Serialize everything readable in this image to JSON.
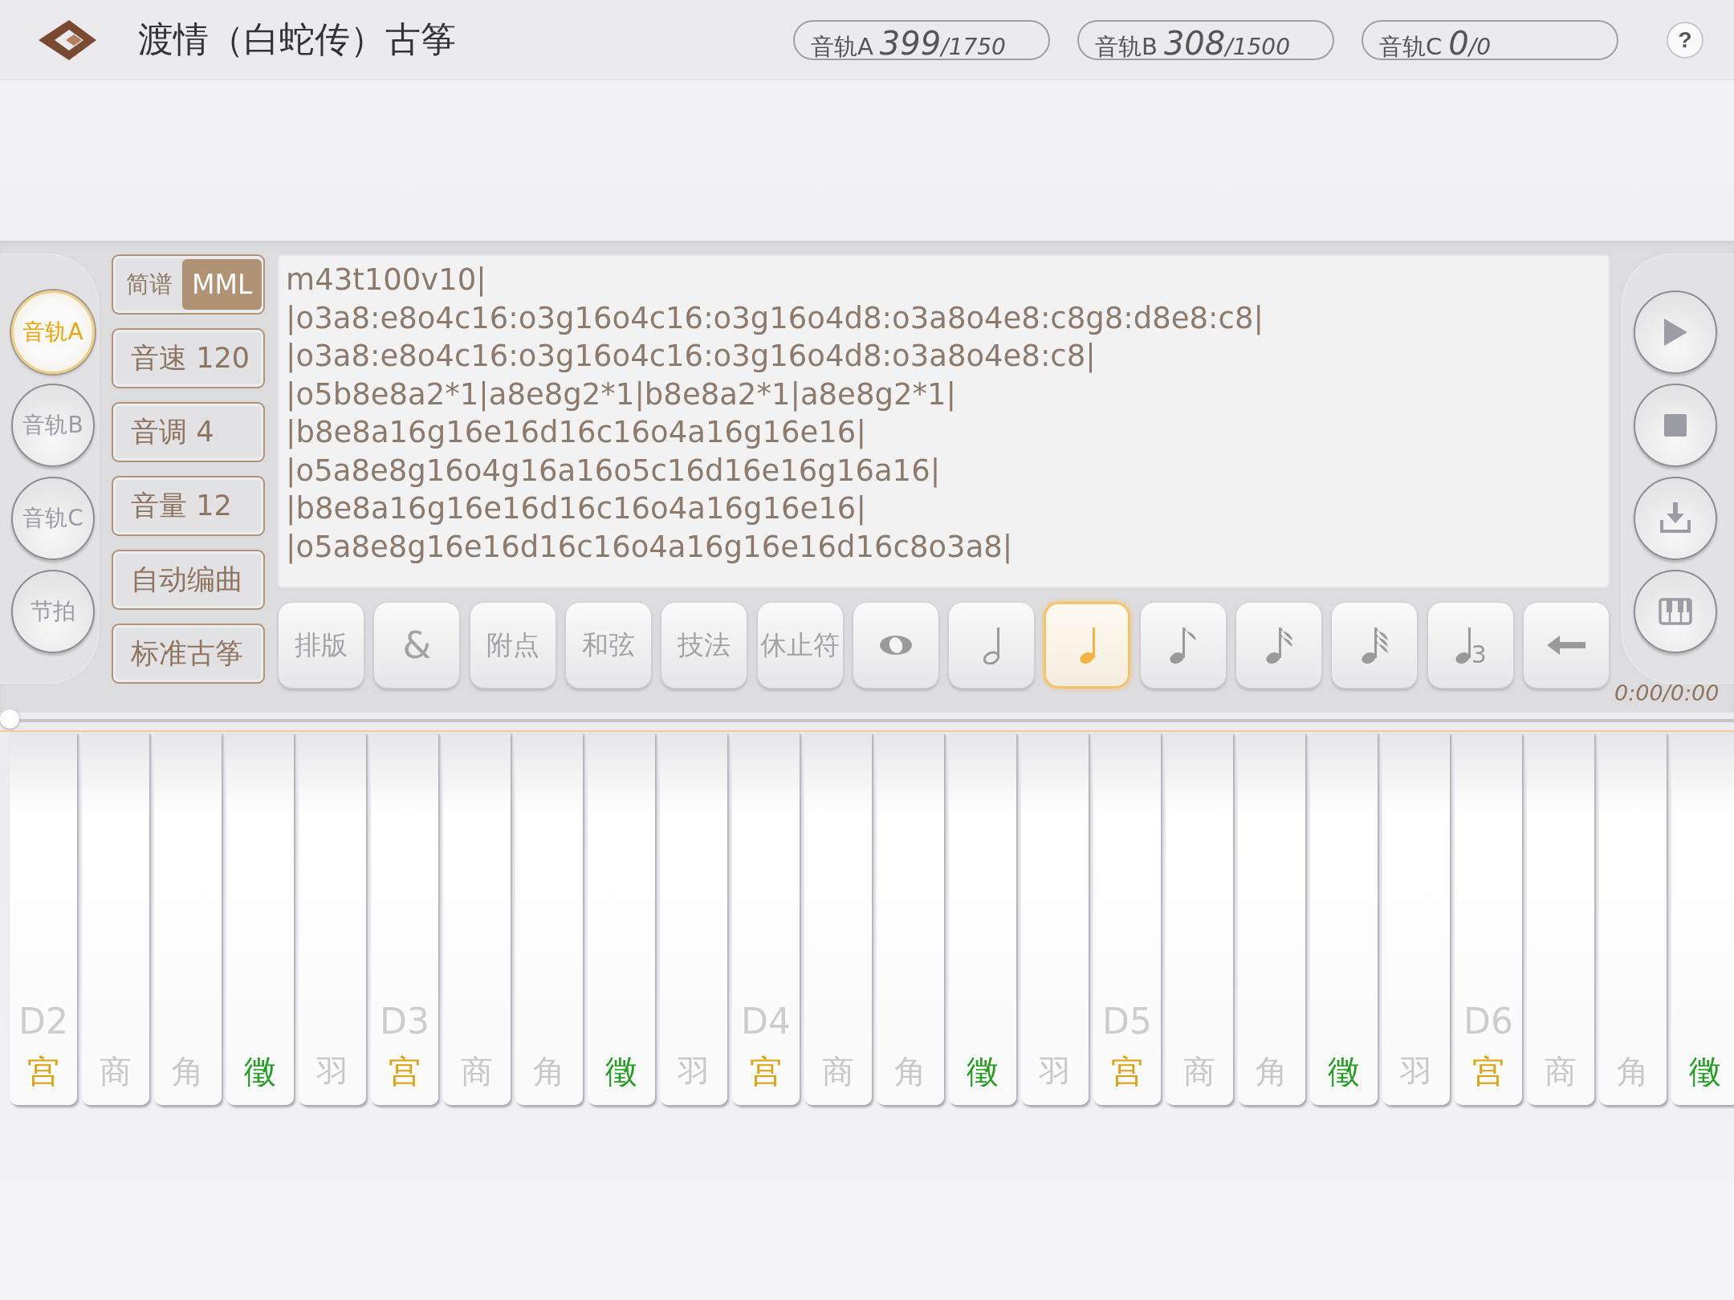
{
  "header": {
    "title": "渡情（白蛇传）古筝",
    "help": "?",
    "tracks": [
      {
        "label": "音轨A",
        "count": "399",
        "total": "/1750"
      },
      {
        "label": "音轨B",
        "count": "308",
        "total": "/1500"
      },
      {
        "label": "音轨C",
        "count": "0",
        "total": "/0"
      }
    ]
  },
  "track_buttons": [
    {
      "label": "音轨A",
      "selected": true
    },
    {
      "label": "音轨B",
      "selected": false
    },
    {
      "label": "音轨C",
      "selected": false
    },
    {
      "label": "节拍",
      "selected": false
    }
  ],
  "mode_toggle": [
    {
      "label": "简谱",
      "selected": false
    },
    {
      "label": "MML",
      "selected": true
    }
  ],
  "settings": [
    "音速 120",
    "音调 4",
    "音量 12",
    "自动编曲",
    "标准古筝"
  ],
  "editor_lines": [
    "m43t100v10|",
    "|o3a8:e8o4c16:o3g16o4c16:o3g16o4d8:o3a8o4e8:c8g8:d8e8:c8|",
    "|o3a8:e8o4c16:o3g16o4c16:o3g16o4d8:o3a8o4e8:c8|",
    "|o5b8e8a2*1|a8e8g2*1|b8e8a2*1|a8e8g2*1|",
    "|b8e8a16g16e16d16c16o4a16g16e16|",
    "|o5a8e8g16o4g16a16o5c16d16e16g16a16|",
    "|b8e8a16g16e16d16c16o4a16g16e16|",
    "|o5a8e8g16e16d16c16o4a16g16e16d16c8o3a8|"
  ],
  "toolbar": [
    {
      "kind": "text",
      "label": "排版",
      "selected": false
    },
    {
      "kind": "text",
      "label": "&",
      "selected": false
    },
    {
      "kind": "text",
      "label": "附点",
      "selected": false
    },
    {
      "kind": "text",
      "label": "和弦",
      "selected": false
    },
    {
      "kind": "text",
      "label": "技法",
      "selected": false
    },
    {
      "kind": "text",
      "label": "休止符",
      "selected": false
    },
    {
      "kind": "whole",
      "selected": false
    },
    {
      "kind": "half",
      "selected": false
    },
    {
      "kind": "quarter",
      "selected": true
    },
    {
      "kind": "eighth",
      "selected": false
    },
    {
      "kind": "sixteenth",
      "selected": false
    },
    {
      "kind": "thirtysecond",
      "selected": false
    },
    {
      "kind": "triplet",
      "label": "3",
      "selected": false
    },
    {
      "kind": "backspace",
      "selected": false
    }
  ],
  "transport": [
    {
      "kind": "play"
    },
    {
      "kind": "stop"
    },
    {
      "kind": "download"
    },
    {
      "kind": "keyboard"
    }
  ],
  "time": "0:00/0:00",
  "progress": {
    "level": 0
  },
  "keys": [
    {
      "octave": "D2",
      "note": "宫",
      "color": "#dba20c"
    },
    {
      "note": "商",
      "color": "#c8c8c8"
    },
    {
      "note": "角",
      "color": "#c8c8c8"
    },
    {
      "note": "徵",
      "color": "#1f9e1f"
    },
    {
      "note": "羽",
      "color": "#c8c8c8"
    },
    {
      "octave": "D3",
      "note": "宫",
      "color": "#dba20c"
    },
    {
      "note": "商",
      "color": "#c8c8c8"
    },
    {
      "note": "角",
      "color": "#c8c8c8"
    },
    {
      "note": "徵",
      "color": "#1f9e1f"
    },
    {
      "note": "羽",
      "color": "#c8c8c8"
    },
    {
      "octave": "D4",
      "note": "宫",
      "color": "#dba20c"
    },
    {
      "note": "商",
      "color": "#c8c8c8"
    },
    {
      "note": "角",
      "color": "#c8c8c8"
    },
    {
      "note": "徵",
      "color": "#1f9e1f"
    },
    {
      "note": "羽",
      "color": "#c8c8c8"
    },
    {
      "octave": "D5",
      "note": "宫",
      "color": "#dba20c"
    },
    {
      "note": "商",
      "color": "#c8c8c8"
    },
    {
      "note": "角",
      "color": "#c8c8c8"
    },
    {
      "note": "徵",
      "color": "#1f9e1f"
    },
    {
      "note": "羽",
      "color": "#c8c8c8"
    },
    {
      "octave": "D6",
      "note": "宫",
      "color": "#dba20c"
    },
    {
      "note": "商",
      "color": "#c8c8c8"
    },
    {
      "note": "角",
      "color": "#c8c8c8"
    },
    {
      "note": "徵",
      "color": "#1f9e1f"
    }
  ]
}
